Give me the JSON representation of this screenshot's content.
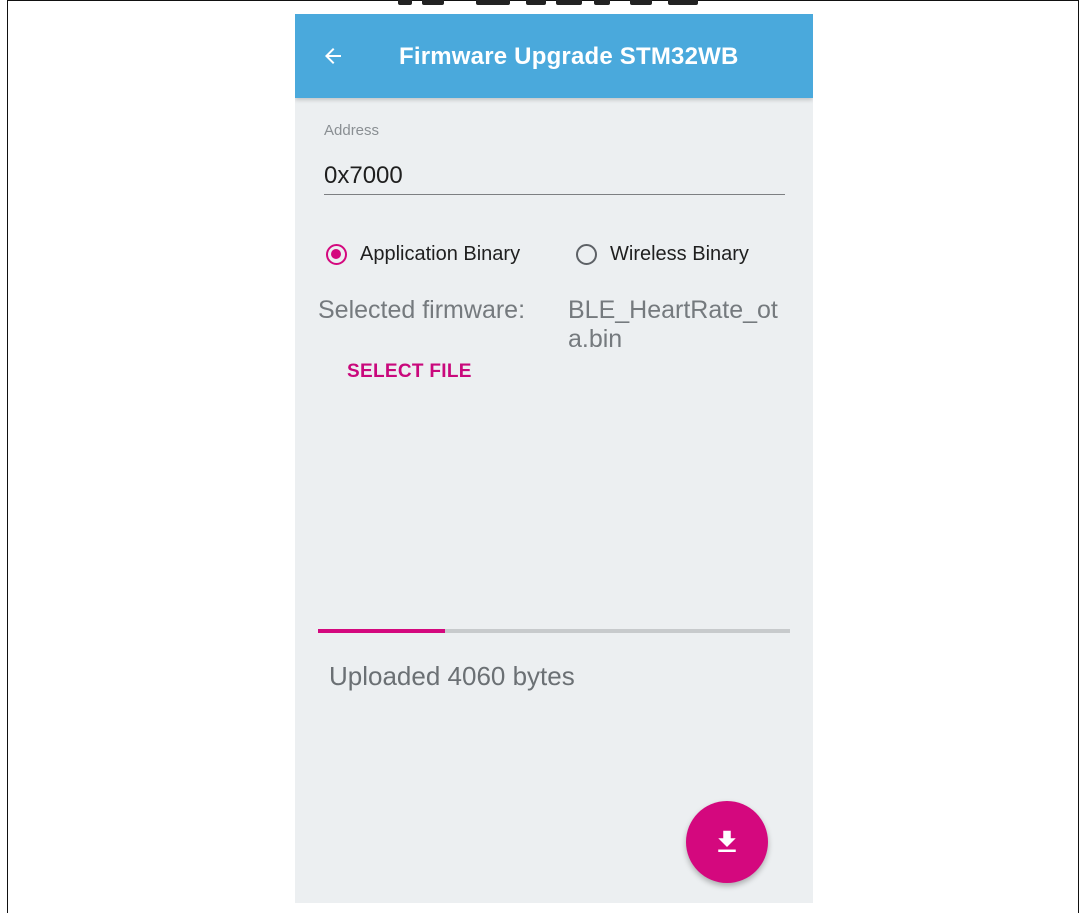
{
  "app_bar": {
    "title": "Firmware Upgrade STM32WB",
    "back_icon": "arrow-left-icon",
    "color": "#4aa9dc"
  },
  "address": {
    "label": "Address",
    "value": "0x7000"
  },
  "binary_type": {
    "options": [
      {
        "label": "Application Binary",
        "selected": true
      },
      {
        "label": "Wireless Binary",
        "selected": false
      }
    ]
  },
  "firmware": {
    "label": "Selected firmware:",
    "value": "BLE_HeartRate_ota.bin",
    "select_button_label": "SELECT FILE"
  },
  "upload": {
    "progress": 0.27,
    "status": "Uploaded 4060 bytes"
  },
  "fab": {
    "icon": "download-icon"
  },
  "colors": {
    "accent": "#d4087e",
    "background": "#eceff1"
  }
}
